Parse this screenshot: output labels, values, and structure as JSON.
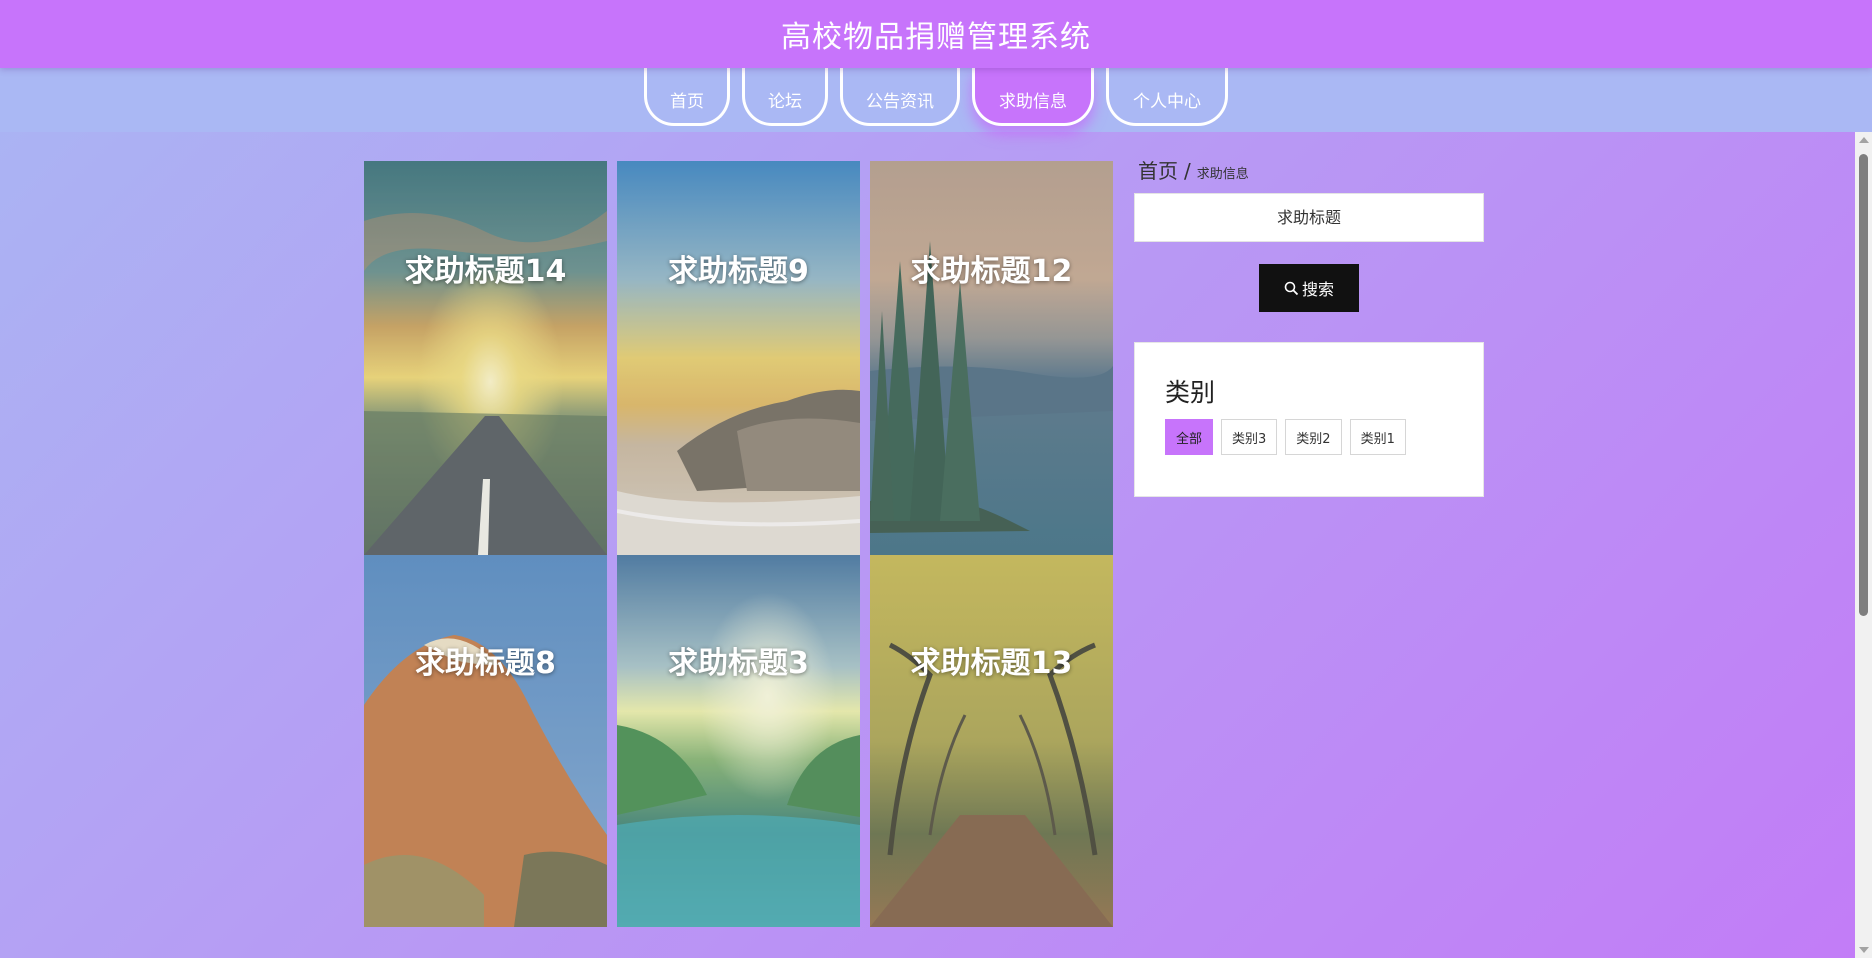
{
  "header": {
    "title": "高校物品捐赠管理系统"
  },
  "nav": {
    "items": [
      {
        "label": "首页",
        "active": false
      },
      {
        "label": "论坛",
        "active": false
      },
      {
        "label": "公告资讯",
        "active": false
      },
      {
        "label": "求助信息",
        "active": true
      },
      {
        "label": "个人中心",
        "active": false
      }
    ]
  },
  "cards": [
    {
      "title": "求助标题14",
      "image": "sunset-road"
    },
    {
      "title": "求助标题9",
      "image": "beach-rocks"
    },
    {
      "title": "求助标题12",
      "image": "lake-island-trees"
    },
    {
      "title": "求助标题8",
      "image": "red-mountain"
    },
    {
      "title": "求助标题3",
      "image": "valley-lake"
    },
    {
      "title": "求助标题13",
      "image": "autumn-avenue"
    }
  ],
  "breadcrumb": {
    "home": "首页",
    "separator": "/",
    "current": "求助信息"
  },
  "search": {
    "placeholder": "求助标题",
    "button_label": "搜索",
    "button_icon": "search-icon"
  },
  "categories": {
    "title": "类别",
    "items": [
      {
        "label": "全部",
        "active": true
      },
      {
        "label": "类别3",
        "active": false
      },
      {
        "label": "类别2",
        "active": false
      },
      {
        "label": "类别1",
        "active": false
      }
    ]
  },
  "colors": {
    "accent": "#c774fb",
    "nav_strip": "#aab8f4",
    "search_button": "#111111"
  }
}
